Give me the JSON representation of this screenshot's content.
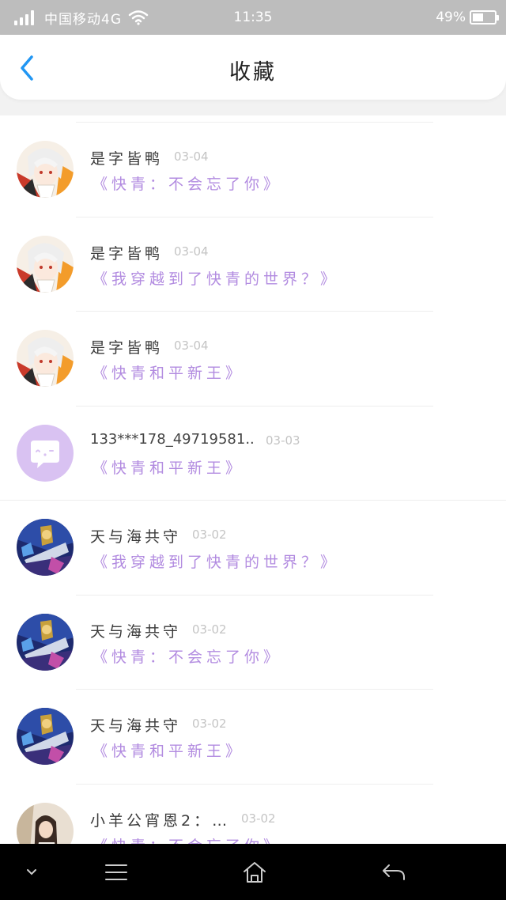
{
  "status_bar": {
    "carrier": "中国移动4G",
    "time": "11:35",
    "battery_percent": "49%",
    "battery_level": 0.49,
    "icons": [
      "signal-icon",
      "wifi-icon",
      "battery-icon"
    ]
  },
  "header": {
    "title": "收藏",
    "back_icon": "chevron-left-icon",
    "accent_color": "#2196f3"
  },
  "favorites": [
    {
      "name": "是字皆鸭",
      "date": "03-04",
      "quote": "《快青：不会忘了你》",
      "avatar": "anime-girl-avatar"
    },
    {
      "name": "是字皆鸭",
      "date": "03-04",
      "quote": "《我穿越到了快青的世界？》",
      "avatar": "anime-girl-avatar"
    },
    {
      "name": "是字皆鸭",
      "date": "03-04",
      "quote": "《快青和平新王》",
      "avatar": "anime-girl-avatar"
    },
    {
      "name": "133***178_49719581..",
      "date": "03-03",
      "quote": "《快青和平新王》",
      "avatar": "chat-bubble-avatar"
    },
    {
      "name": "天与海共守",
      "date": "03-02",
      "quote": "《我穿越到了快青的世界？》",
      "avatar": "game-character-avatar"
    },
    {
      "name": "天与海共守",
      "date": "03-02",
      "quote": "《快青：不会忘了你》",
      "avatar": "game-character-avatar"
    },
    {
      "name": "天与海共守",
      "date": "03-02",
      "quote": "《快青和平新王》",
      "avatar": "game-character-avatar"
    },
    {
      "name": "小羊公宵恩2：…",
      "date": "03-02",
      "quote": "《快青：不会忘了你》",
      "avatar": "portrait-photo-avatar"
    }
  ],
  "colors": {
    "quote": "#b28be0",
    "name": "#3a3a3a",
    "date": "#c4c4c4",
    "chat_avatar_bg": "#d9c2f2"
  },
  "nav_bar": {
    "icons": [
      "chevron-down-icon",
      "menu-icon",
      "home-icon",
      "back-arrow-icon"
    ]
  }
}
